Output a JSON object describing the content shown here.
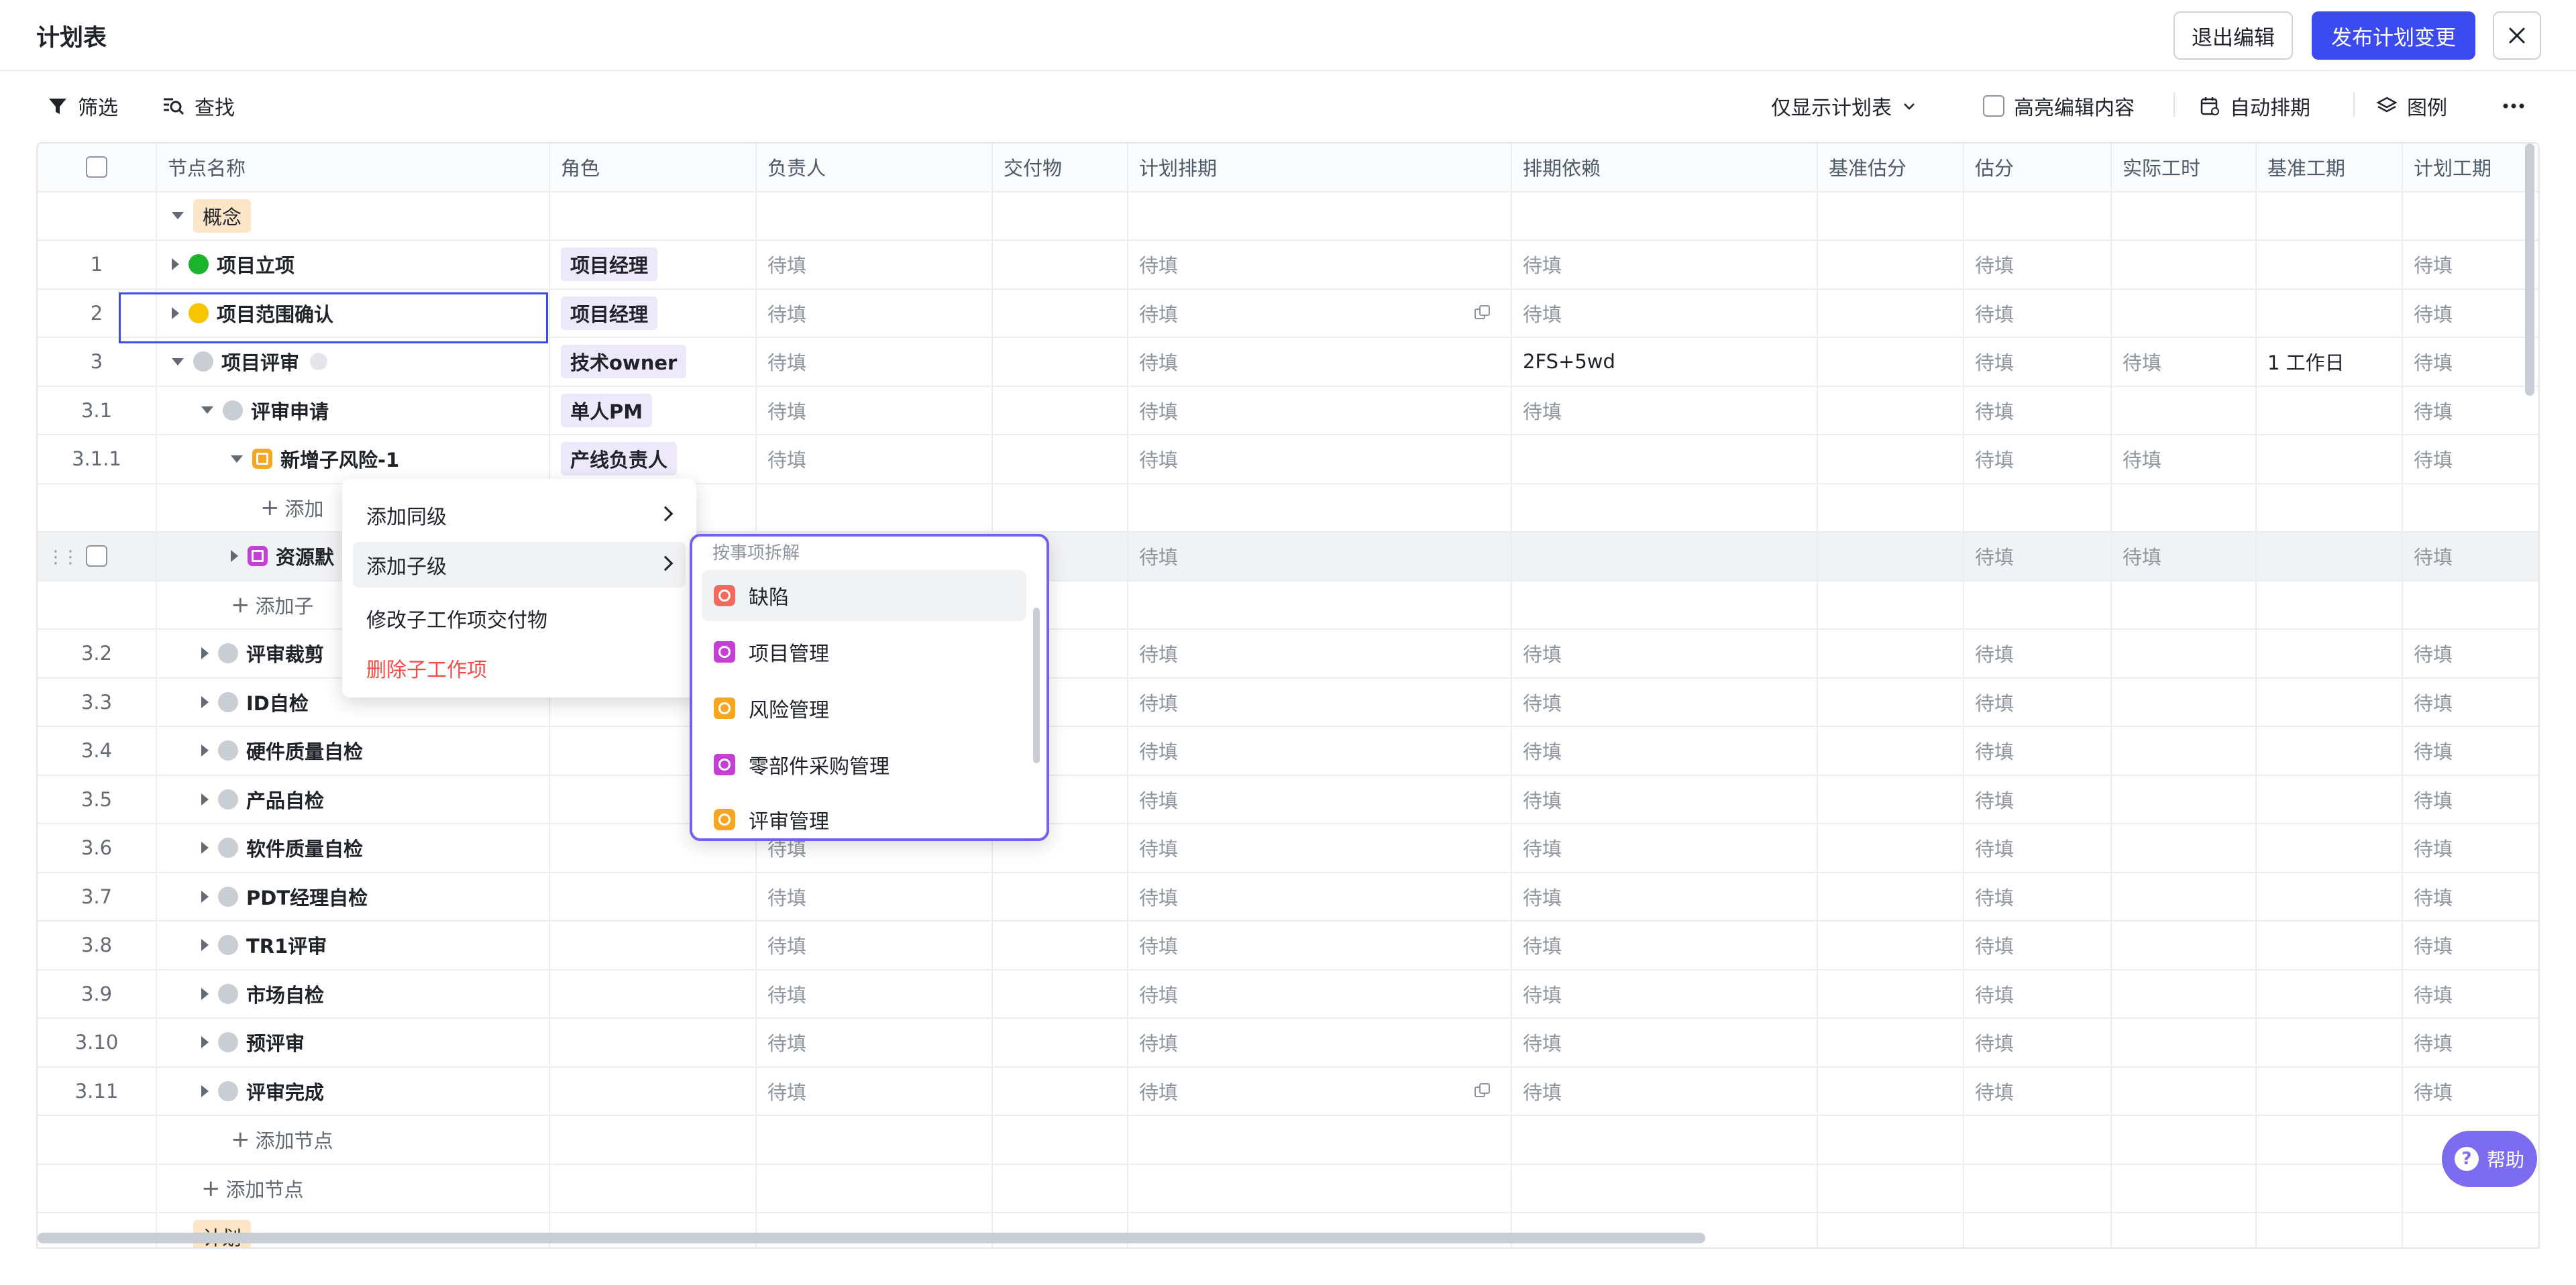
{
  "header": {
    "title": "计划表",
    "exit_edit": "退出编辑",
    "publish": "发布计划变更"
  },
  "toolbar": {
    "filter": "筛选",
    "search": "查找",
    "view_select": "仅显示计划表",
    "highlight": "高亮编辑内容",
    "auto_schedule": "自动排期",
    "legend": "图例"
  },
  "columns": [
    "节点名称",
    "角色",
    "负责人",
    "交付物",
    "计划排期",
    "排期依赖",
    "基准估分",
    "估分",
    "实际工时",
    "基准工期",
    "计划工期"
  ],
  "placeholder": "待填",
  "rows": [
    {
      "num": "",
      "name": "概念"
    },
    {
      "num": "1",
      "name": "项目立项",
      "role": "项目经理"
    },
    {
      "num": "2",
      "name": "项目范围确认",
      "role": "项目经理"
    },
    {
      "num": "3",
      "name": "项目评审",
      "role": "技术owner",
      "dependency": "2FS+5wd",
      "actual": "待填",
      "baseline_duration": "1 工作日"
    },
    {
      "num": "3.1",
      "name": "评审申请",
      "role": "单人PM"
    },
    {
      "num": "3.1.1",
      "name": "新增子风险-1",
      "role": "产线负责人",
      "actual": "待填"
    },
    {
      "num": "",
      "name": "添加"
    },
    {
      "num": "",
      "name": "资源默",
      "actual": "待填"
    },
    {
      "num": "",
      "name": "添加子"
    },
    {
      "num": "3.2",
      "name": "评审裁剪"
    },
    {
      "num": "3.3",
      "name": "ID自检"
    },
    {
      "num": "3.4",
      "name": "硬件质量自检"
    },
    {
      "num": "3.5",
      "name": "产品自检"
    },
    {
      "num": "3.6",
      "name": "软件质量自检"
    },
    {
      "num": "3.7",
      "name": "PDT经理自检"
    },
    {
      "num": "3.8",
      "name": "TR1评审"
    },
    {
      "num": "3.9",
      "name": "市场自检"
    },
    {
      "num": "3.10",
      "name": "预评审"
    },
    {
      "num": "3.11",
      "name": "评审完成"
    },
    {
      "num": "",
      "name": "添加节点"
    },
    {
      "num": "",
      "name": "添加节点"
    },
    {
      "num": "",
      "name": "计划"
    }
  ],
  "context_menu": {
    "add_sibling": "添加同级",
    "add_child": "添加子级",
    "modify_deliverable": "修改子工作项交付物",
    "delete_child": "删除子工作项"
  },
  "submenu": {
    "header": "按事项拆解",
    "items": [
      {
        "label": "缺陷",
        "color": "#f46a5e"
      },
      {
        "label": "项目管理",
        "color": "#c43fd6"
      },
      {
        "label": "风险管理",
        "color": "#f5a623"
      },
      {
        "label": "零部件采购管理",
        "color": "#c43fd6"
      },
      {
        "label": "评审管理",
        "color": "#f5a623"
      }
    ]
  },
  "help": "帮助",
  "colors": {
    "primary": "#3c4bf0",
    "status_green": "#19b32c",
    "status_yellow": "#f7c500",
    "status_gray": "#c9cdd4",
    "danger": "#f54a45"
  }
}
